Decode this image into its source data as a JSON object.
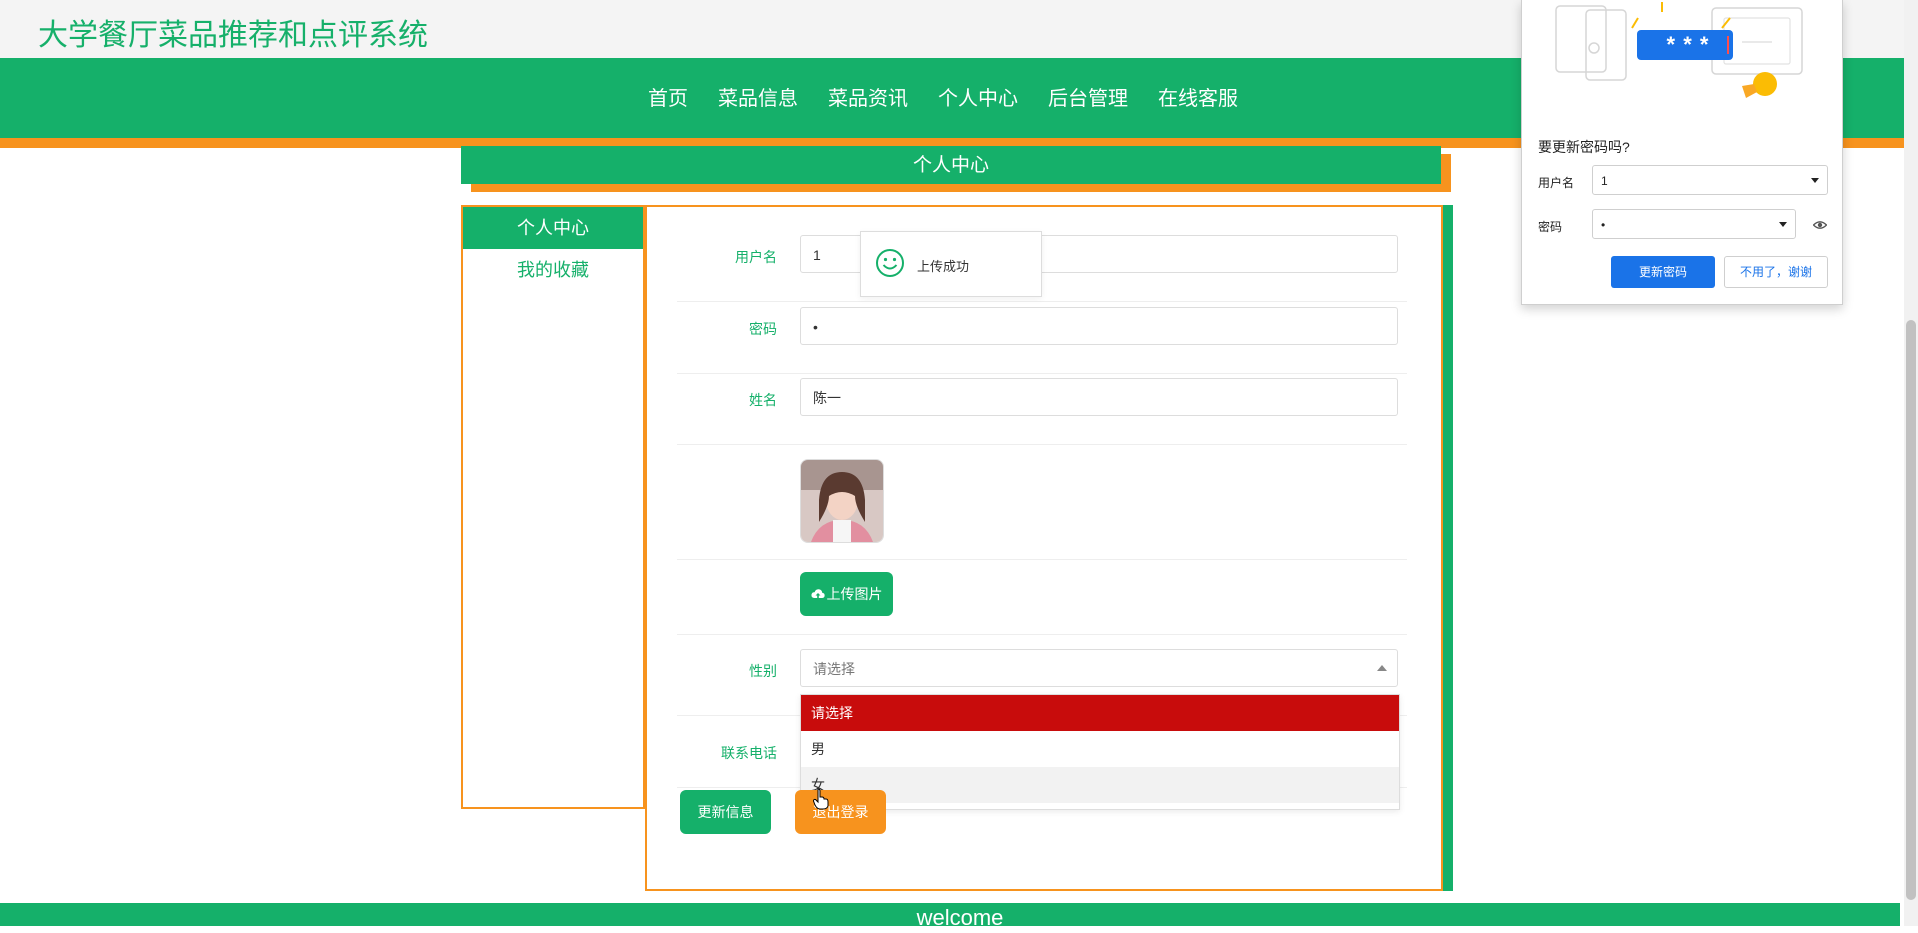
{
  "site": {
    "title": "大学餐厅菜品推荐和点评系统"
  },
  "nav": {
    "items": [
      {
        "label": "首页"
      },
      {
        "label": "菜品信息"
      },
      {
        "label": "菜品资讯"
      },
      {
        "label": "个人中心"
      },
      {
        "label": "后台管理"
      },
      {
        "label": "在线客服"
      }
    ]
  },
  "section": {
    "title": "个人中心"
  },
  "sidebar": {
    "items": [
      {
        "label": "个人中心"
      },
      {
        "label": "我的收藏"
      }
    ]
  },
  "form": {
    "username": {
      "label": "用户名",
      "value": "1"
    },
    "password": {
      "label": "密码",
      "value": "•"
    },
    "name": {
      "label": "姓名",
      "value": "陈一"
    },
    "upload_button": "上传图片",
    "gender": {
      "label": "性别",
      "placeholder": "请选择",
      "options": [
        "请选择",
        "男",
        "女"
      ]
    },
    "phone": {
      "label": "联系电话"
    },
    "update_button": "更新信息",
    "logout_button": "退出登录"
  },
  "toast": {
    "message": "上传成功"
  },
  "footer": {
    "text": "welcome"
  },
  "password_popup": {
    "question": "要更新密码吗?",
    "username_label": "用户名",
    "username_value": "1",
    "password_label": "密码",
    "password_value": "•",
    "illustration_text": "* * *",
    "primary_button": "更新密码",
    "secondary_button": "不用了，谢谢"
  },
  "colors": {
    "brand_green": "#15b06a",
    "accent_orange": "#f7931e",
    "selected_red": "#c80c0c",
    "chrome_blue": "#1a73e8"
  }
}
